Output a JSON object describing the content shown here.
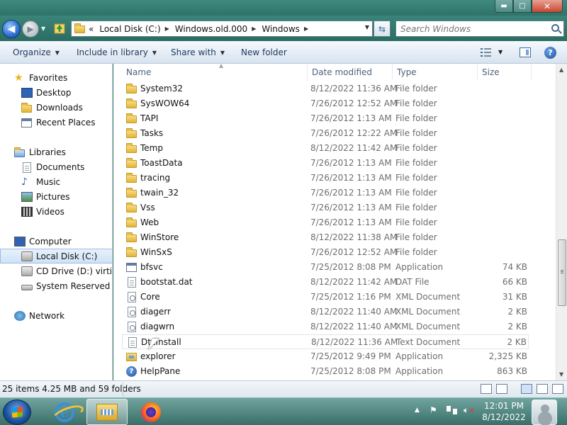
{
  "window": {
    "caption_min": "▬",
    "caption_max": "□",
    "caption_close": "✕"
  },
  "address": {
    "overflow": "«",
    "crumbs": [
      "Local Disk (C:)",
      "Windows.old.000",
      "Windows"
    ]
  },
  "search": {
    "placeholder": "Search Windows"
  },
  "toolbar": {
    "organize": "Organize",
    "include": "Include in library",
    "share": "Share with",
    "new_folder": "New folder",
    "help": "?"
  },
  "nav": {
    "favorites": "Favorites",
    "desktop": "Desktop",
    "downloads": "Downloads",
    "recent": "Recent Places",
    "libraries": "Libraries",
    "documents": "Documents",
    "music": "Music",
    "pictures": "Pictures",
    "videos": "Videos",
    "computer": "Computer",
    "local_disk": "Local Disk (C:)",
    "cd_drive": "CD Drive (D:) virtio-w",
    "system_reserved": "System Reserved (E:)",
    "network": "Network"
  },
  "columns": {
    "name": "Name",
    "date": "Date modified",
    "type": "Type",
    "size": "Size"
  },
  "files": [
    {
      "name": "System32",
      "date": "8/12/2022 11:36 AM",
      "type": "File folder",
      "size": "",
      "icon": "folder"
    },
    {
      "name": "SysWOW64",
      "date": "7/26/2012 12:52 AM",
      "type": "File folder",
      "size": "",
      "icon": "folder"
    },
    {
      "name": "TAPI",
      "date": "7/26/2012 1:13 AM",
      "type": "File folder",
      "size": "",
      "icon": "folder"
    },
    {
      "name": "Tasks",
      "date": "7/26/2012 12:22 AM",
      "type": "File folder",
      "size": "",
      "icon": "folder"
    },
    {
      "name": "Temp",
      "date": "8/12/2022 11:42 AM",
      "type": "File folder",
      "size": "",
      "icon": "folder"
    },
    {
      "name": "ToastData",
      "date": "7/26/2012 1:13 AM",
      "type": "File folder",
      "size": "",
      "icon": "folder"
    },
    {
      "name": "tracing",
      "date": "7/26/2012 1:13 AM",
      "type": "File folder",
      "size": "",
      "icon": "folder"
    },
    {
      "name": "twain_32",
      "date": "7/26/2012 1:13 AM",
      "type": "File folder",
      "size": "",
      "icon": "folder"
    },
    {
      "name": "Vss",
      "date": "7/26/2012 1:13 AM",
      "type": "File folder",
      "size": "",
      "icon": "folder"
    },
    {
      "name": "Web",
      "date": "7/26/2012 1:13 AM",
      "type": "File folder",
      "size": "",
      "icon": "folder"
    },
    {
      "name": "WinStore",
      "date": "8/12/2022 11:38 AM",
      "type": "File folder",
      "size": "",
      "icon": "folder"
    },
    {
      "name": "WinSxS",
      "date": "7/26/2012 12:52 AM",
      "type": "File folder",
      "size": "",
      "icon": "folder"
    },
    {
      "name": "bfsvc",
      "date": "7/25/2012 8:08 PM",
      "type": "Application",
      "size": "74 KB",
      "icon": "app"
    },
    {
      "name": "bootstat.dat",
      "date": "8/12/2022 11:42 AM",
      "type": "DAT File",
      "size": "66 KB",
      "icon": "doc"
    },
    {
      "name": "Core",
      "date": "7/25/2012 1:16 PM",
      "type": "XML Document",
      "size": "31 KB",
      "icon": "xml"
    },
    {
      "name": "diagerr",
      "date": "8/12/2022 11:40 AM",
      "type": "XML Document",
      "size": "2 KB",
      "icon": "xml"
    },
    {
      "name": "diagwrn",
      "date": "8/12/2022 11:40 AM",
      "type": "XML Document",
      "size": "2 KB",
      "icon": "xml"
    },
    {
      "name": "DtcInstall",
      "date": "8/12/2022 11:36 AM",
      "type": "Text Document",
      "size": "2 KB",
      "icon": "doc"
    },
    {
      "name": "explorer",
      "date": "7/25/2012 9:49 PM",
      "type": "Application",
      "size": "2,325 KB",
      "icon": "explorer"
    },
    {
      "name": "HelpPane",
      "date": "7/25/2012 8:08 PM",
      "type": "Application",
      "size": "863 KB",
      "icon": "help"
    }
  ],
  "status": {
    "text": "25 items 4.25 MB and 59 folders"
  },
  "taskbar": {
    "time": "12:01 PM",
    "date": "8/12/2022"
  }
}
